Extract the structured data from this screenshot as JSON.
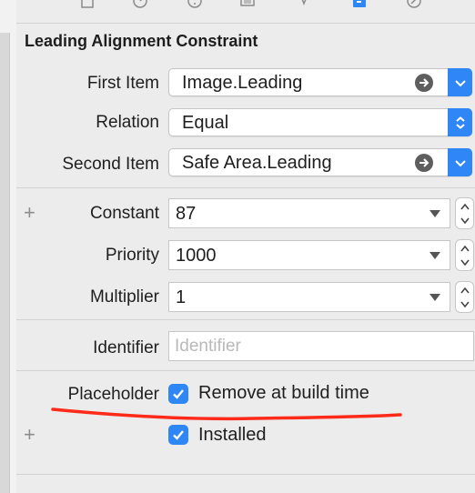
{
  "toolbar": {
    "icons": [
      "file-icon",
      "history-icon",
      "help-icon",
      "identity-icon",
      "attributes-icon",
      "size-inspector-icon",
      "connections-icon"
    ],
    "active_icon": "size-inspector-icon"
  },
  "section": {
    "title": "Leading Alignment Constraint"
  },
  "first_item": {
    "label": "First Item",
    "value": "Image.Leading"
  },
  "relation": {
    "label": "Relation",
    "value": "Equal"
  },
  "second_item": {
    "label": "Second Item",
    "value": "Safe Area.Leading"
  },
  "constant": {
    "label": "Constant",
    "value": "87"
  },
  "priority": {
    "label": "Priority",
    "value": "1000"
  },
  "multiplier": {
    "label": "Multiplier",
    "value": "1"
  },
  "identifier": {
    "label": "Identifier",
    "placeholder": "Identifier"
  },
  "placeholder": {
    "label": "Placeholder",
    "checkbox_label": "Remove at build time",
    "checked": true
  },
  "installed": {
    "label": "Installed",
    "checked": true
  },
  "colors": {
    "accent": "#2f86f5",
    "annotation": "#ff2a1a",
    "background": "#ececec"
  }
}
